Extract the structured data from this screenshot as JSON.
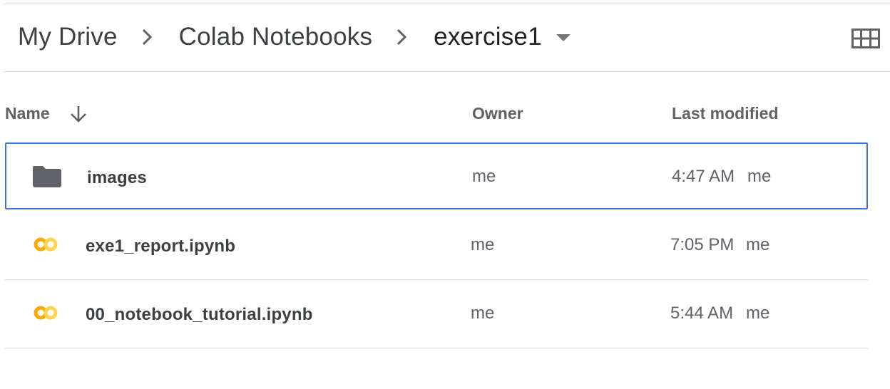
{
  "breadcrumb": {
    "items": [
      "My Drive",
      "Colab Notebooks",
      "exercise1"
    ]
  },
  "icons": {
    "separator": "chevron-right-icon",
    "caret": "caret-down-icon",
    "view": "grid-view-icon",
    "sort": "arrow-down-icon",
    "folder": "folder-icon",
    "colab": "colab-logo-icon"
  },
  "columns": {
    "name": "Name",
    "owner": "Owner",
    "last_modified": "Last modified"
  },
  "files": [
    {
      "name": "images",
      "type": "folder",
      "owner": "me",
      "modified": "4:47 AM",
      "modified_by": "me",
      "selected": true
    },
    {
      "name": "exe1_report.ipynb",
      "type": "colab",
      "owner": "me",
      "modified": "7:05 PM",
      "modified_by": "me",
      "selected": false
    },
    {
      "name": "00_notebook_tutorial.ipynb",
      "type": "colab",
      "owner": "me",
      "modified": "5:44 AM",
      "modified_by": "me",
      "selected": false
    }
  ],
  "colors": {
    "selection_border": "#3e76d6",
    "folder": "#5f6368",
    "colab_orange": "#f9ab00",
    "colab_yellow": "#ffd54f"
  }
}
